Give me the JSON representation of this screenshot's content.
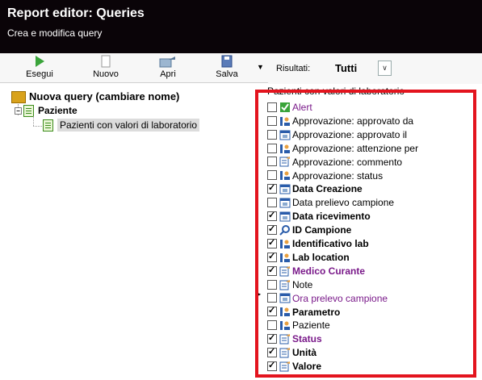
{
  "window": {
    "title": "Report editor: Queries",
    "subtitle": "Crea e modifica query"
  },
  "toolbar": {
    "run_label": "Esegui",
    "new_label": "Nuovo",
    "open_label": "Apri",
    "save_label": "Salva"
  },
  "filter": {
    "label": "Risultati:",
    "value": "Tutti"
  },
  "tree": {
    "root": "Nuova query (cambiare nome)",
    "child": "Paziente",
    "leaf": "Pazienti con valori di laboratorio"
  },
  "fields_panel": {
    "header": "Pazienti con valori di laboratorio",
    "items": [
      {
        "label": "Alert",
        "checked": false,
        "style": "purple",
        "icon": "alert-check-icon"
      },
      {
        "label": "Approvazione: approvato da",
        "checked": false,
        "style": "normal",
        "icon": "user-field-icon"
      },
      {
        "label": "Approvazione: approvato il",
        "checked": false,
        "style": "normal",
        "icon": "date-field-icon"
      },
      {
        "label": "Approvazione: attenzione per",
        "checked": false,
        "style": "normal",
        "icon": "user-field-icon"
      },
      {
        "label": "Approvazione: commento",
        "checked": false,
        "style": "normal",
        "icon": "text-field-icon"
      },
      {
        "label": "Approvazione: status",
        "checked": false,
        "style": "normal",
        "icon": "user-field-icon"
      },
      {
        "label": "Data Creazione",
        "checked": true,
        "style": "bold",
        "icon": "date-field-icon"
      },
      {
        "label": "Data prelievo campione",
        "checked": false,
        "style": "normal",
        "icon": "date-field-icon"
      },
      {
        "label": "Data ricevimento",
        "checked": true,
        "style": "bold",
        "icon": "date-field-icon"
      },
      {
        "label": "ID Campione",
        "checked": true,
        "style": "bold",
        "icon": "key-icon"
      },
      {
        "label": "Identificativo lab",
        "checked": true,
        "style": "bold",
        "icon": "user-field-icon"
      },
      {
        "label": "Lab location",
        "checked": true,
        "style": "bold",
        "icon": "user-field-icon"
      },
      {
        "label": "Medico Curante",
        "checked": true,
        "style": "bold-purple",
        "icon": "text-field-icon"
      },
      {
        "label": "Note",
        "checked": false,
        "style": "normal",
        "icon": "text-field-icon"
      },
      {
        "label": "Ora prelevo campione",
        "checked": false,
        "style": "purple",
        "icon": "date-field-icon"
      },
      {
        "label": "Parametro",
        "checked": true,
        "style": "bold",
        "icon": "user-field-icon"
      },
      {
        "label": "Paziente",
        "checked": false,
        "style": "normal",
        "icon": "user-field-icon"
      },
      {
        "label": "Status",
        "checked": true,
        "style": "bold-purple",
        "icon": "text-field-icon"
      },
      {
        "label": "Unità",
        "checked": true,
        "style": "bold",
        "icon": "text-field-icon"
      },
      {
        "label": "Valore",
        "checked": true,
        "style": "bold",
        "icon": "text-field-icon"
      }
    ]
  },
  "colors": {
    "titlebar_bg": "#0a0408",
    "highlight_border": "#e3141e",
    "purple_text": "#7a1a8a"
  }
}
